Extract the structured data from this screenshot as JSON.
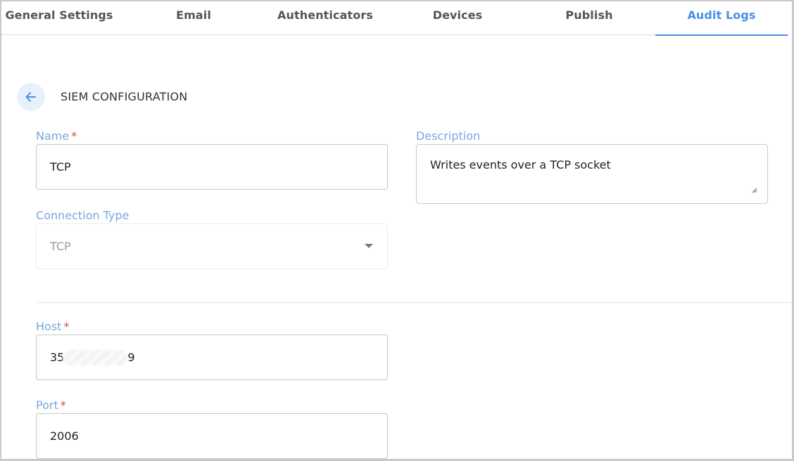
{
  "tabs": [
    {
      "label": "General Settings",
      "active": false
    },
    {
      "label": "Email",
      "active": false
    },
    {
      "label": "Authenticators",
      "active": false
    },
    {
      "label": "Devices",
      "active": false
    },
    {
      "label": "Publish",
      "active": false
    },
    {
      "label": "Audit Logs",
      "active": true
    }
  ],
  "header": {
    "back_icon": "arrow-left-icon",
    "title": "SIEM CONFIGURATION"
  },
  "form": {
    "name": {
      "label": "Name",
      "required_mark": "*",
      "value": "TCP"
    },
    "description": {
      "label": "Description",
      "value": "Writes events over a TCP socket"
    },
    "connection_type": {
      "label": "Connection Type",
      "value": "TCP",
      "disabled": true
    },
    "host": {
      "label": "Host",
      "required_mark": "*",
      "value_prefix": "35",
      "value_suffix": "9",
      "redacted": true
    },
    "port": {
      "label": "Port",
      "required_mark": "*",
      "value": "2006"
    }
  },
  "colors": {
    "accent": "#4a90e2",
    "label": "#7aa7e0",
    "required": "#e0453a"
  }
}
